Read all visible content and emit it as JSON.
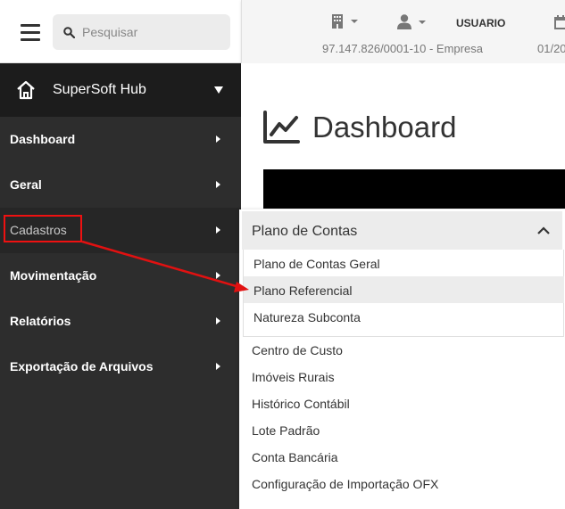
{
  "search": {
    "placeholder": "Pesquisar",
    "icon": "search-icon"
  },
  "header": {
    "building_icon": "building-icon",
    "user_icon": "user-icon",
    "user_label": "USUARIO",
    "calendar_icon": "calendar-icon",
    "company": "97.147.826/0001-10 - Empresa",
    "date_partial": "01/20"
  },
  "sidebar": {
    "title": "SuperSoft Hub",
    "items": [
      {
        "label": "Dashboard"
      },
      {
        "label": "Geral"
      },
      {
        "label": "Cadastros"
      },
      {
        "label": "Movimentação"
      },
      {
        "label": "Relatórios"
      },
      {
        "label": "Exportação de Arquivos"
      }
    ]
  },
  "main": {
    "title": "Dashboard"
  },
  "flyout": {
    "group_title": "Plano de Contas",
    "group_items": [
      {
        "label": "Plano de Contas Geral"
      },
      {
        "label": "Plano Referencial"
      },
      {
        "label": "Natureza Subconta"
      }
    ],
    "items": [
      {
        "label": "Centro de Custo"
      },
      {
        "label": "Imóveis Rurais"
      },
      {
        "label": "Histórico Contábil"
      },
      {
        "label": "Lote Padrão"
      },
      {
        "label": "Conta Bancária"
      },
      {
        "label": "Configuração de Importação OFX"
      }
    ]
  },
  "colors": {
    "sidebar_bg": "#2d2d2d",
    "sidebar_head_bg": "#1c1c1c",
    "annotation": "#e11111",
    "hover_bg": "#ececec"
  }
}
